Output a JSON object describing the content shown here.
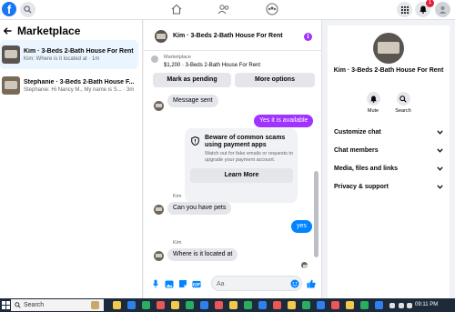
{
  "topbar": {
    "logo_letter": "f",
    "notification_count": "1"
  },
  "left": {
    "title": "Marketplace",
    "conversations": [
      {
        "name": "Kim · 3-Beds 2-Bath House For Rent",
        "snippet": "Kim: Where is it located at · 1m"
      },
      {
        "name": "Stephanie · 3-Beds 2-Bath House F...",
        "snippet": "Stephanie: Hi Nancy M., My name is S... · 3m"
      }
    ]
  },
  "chat": {
    "title": "Kim · 3-Beds 2-Bath House For Rent",
    "marketplace_label": "Marketplace",
    "listing_price": "$1,200 · 3-Beds 2-Bath House For Rent",
    "mark_pending": "Mark as pending",
    "more_options": "More options",
    "messages": {
      "msg_sent": "Message sent",
      "is_available": "Yes it is available",
      "sender_kim_1": "Kim",
      "pets": "Can you have pets",
      "yes": "yes",
      "sender_kim_2": "Kim",
      "located": "Where is it located at"
    },
    "warning": {
      "title": "Beware of common scams using payment apps",
      "body": "Watch out for fake emails or requests to upgrade your payment account.",
      "button": "Learn More"
    },
    "composer_placeholder": "Aa"
  },
  "right": {
    "name": "Kim · 3-Beds 2-Bath House For Rent",
    "actions": [
      "Mute",
      "Search"
    ],
    "sections": [
      "Customize chat",
      "Chat members",
      "Media, files and links",
      "Privacy & support"
    ]
  },
  "taskbar": {
    "search": "Search",
    "time": "09:11 PM"
  },
  "colors": {
    "brand_blue": "#1877f2",
    "purple": "#a033ff",
    "outgoing_bubble": "#0084ff"
  }
}
